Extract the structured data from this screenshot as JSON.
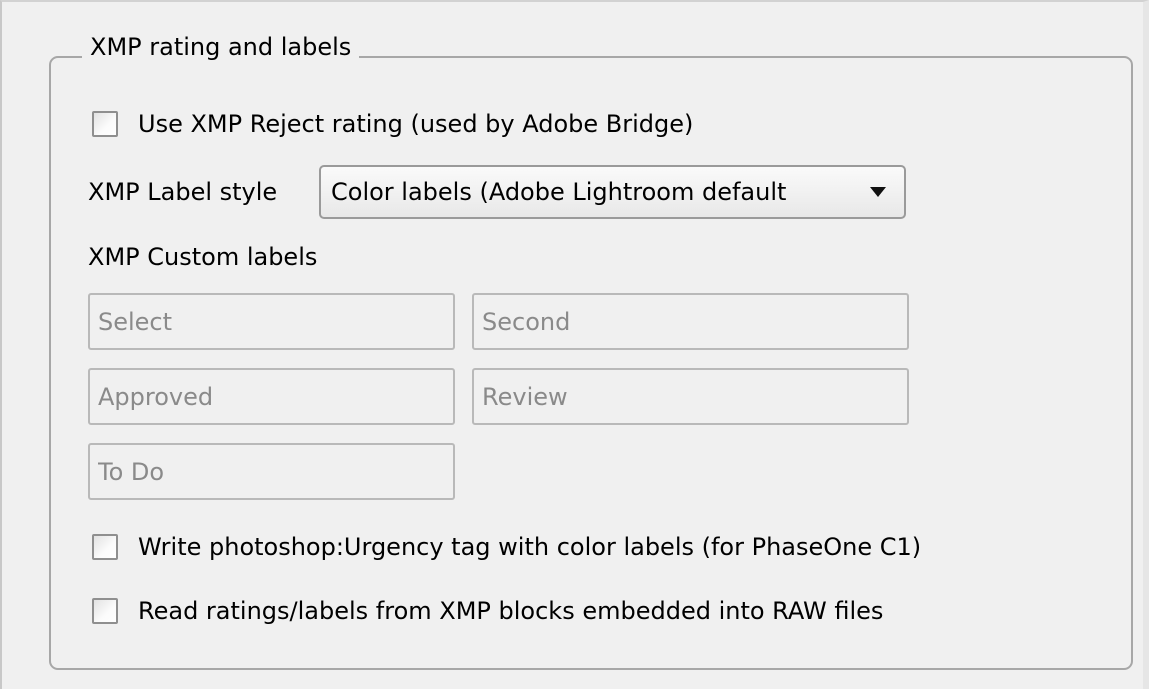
{
  "group": {
    "title": "XMP rating and labels"
  },
  "reject_rating": {
    "label": "Use XMP Reject rating (used by Adobe Bridge)",
    "checked": false
  },
  "label_style": {
    "label": "XMP Label style",
    "selected": "Color labels (Adobe Lightroom default"
  },
  "custom_labels": {
    "heading": "XMP Custom labels",
    "fields": [
      "Select",
      "Second",
      "Approved",
      "Review",
      "To Do"
    ]
  },
  "urgency_tag": {
    "label": "Write photoshop:Urgency tag with color labels (for PhaseOne C1)",
    "checked": false
  },
  "raw_embedded": {
    "label": "Read ratings/labels from XMP blocks embedded into RAW files",
    "checked": false
  },
  "colors": {
    "background": "#f0f0f0",
    "group_border": "#a7a7a7",
    "disabled_text": "#8a8a8a"
  }
}
